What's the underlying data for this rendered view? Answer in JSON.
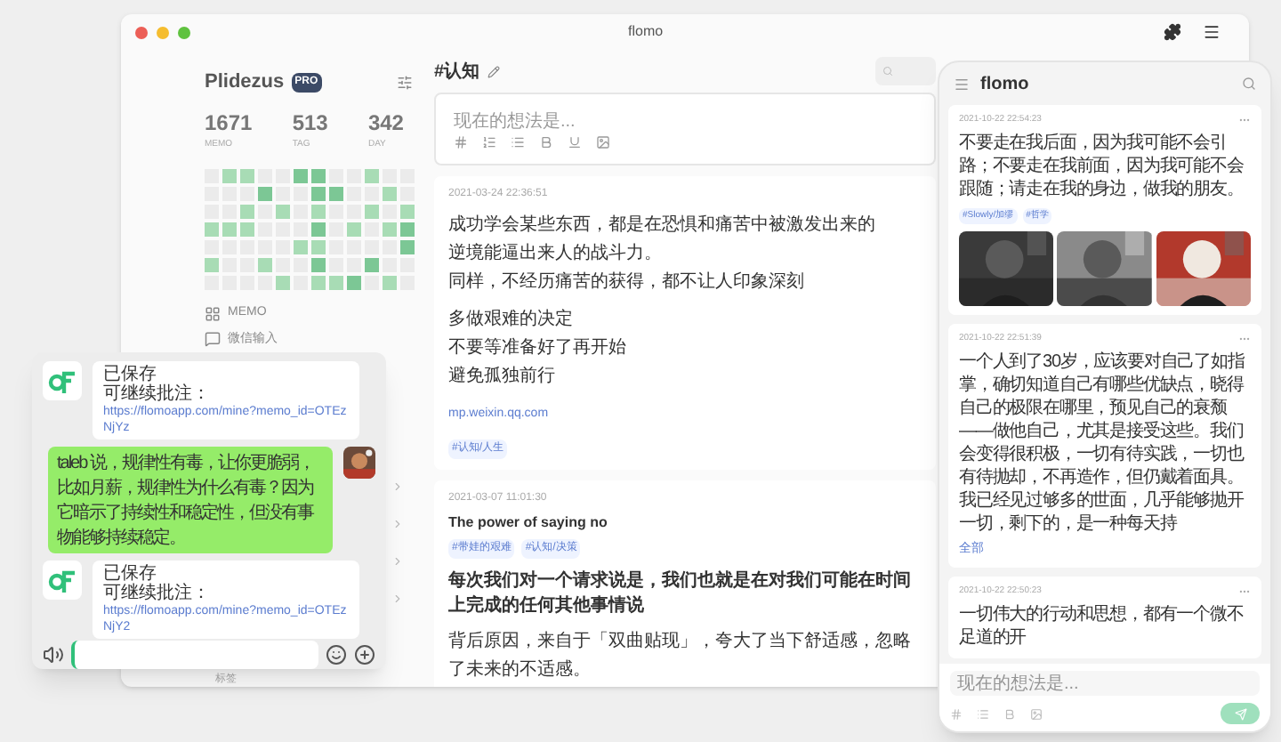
{
  "window": {
    "title": "flomo"
  },
  "sidebar": {
    "user": "Plidezus",
    "badge": "PRO",
    "stats": [
      {
        "value": "1671",
        "label": "MEMO"
      },
      {
        "value": "513",
        "label": "TAG"
      },
      {
        "value": "342",
        "label": "DAY"
      }
    ],
    "items": [
      {
        "kind": "memo",
        "label": "MEMO"
      },
      {
        "kind": "wechat",
        "label": "微信输入"
      }
    ],
    "footer": "标签"
  },
  "main": {
    "title": "#认知",
    "editor": {
      "placeholder": "现在的想法是..."
    },
    "memos": [
      {
        "time": "2021-03-24 22:36:51",
        "paragraphs": [
          [
            "成功学会某些东西，都是在恐惧和痛苦中被激发出来的",
            "逆境能逼出来人的战斗力。",
            "同样，不经历痛苦的获得，都不让人印象深刻"
          ],
          [
            "多做艰难的决定",
            "不要等准备好了再开始",
            "避免孤独前行"
          ]
        ],
        "link": "mp.weixin.qq.com",
        "tags": [
          "#认知/人生"
        ]
      },
      {
        "time": "2021-03-07 11:01:30",
        "title": "The power of saying no",
        "tags": [
          "#带娃的艰难",
          "#认知/决策"
        ],
        "lead": "每次我们对一个请求说是，我们也就是在对我们可能在时间上完成的任何其他事情说",
        "paragraphs": [
          [
            "背后原因，来自于「双曲贴现」，夸大了当下舒适感，忽略了未来的不适感。"
          ]
        ]
      }
    ]
  },
  "phone": {
    "brand": "flomo",
    "memos": [
      {
        "time": "2021-10-22 22:54:23",
        "text": "不要走在我后面，因为我可能不会引路；不要走在我前面，因为我可能不会跟随；请走在我的身边，做我的朋友。",
        "tags": [
          "#Slowly/加缪",
          "#哲学"
        ],
        "pictures": [
          {
            "kind": "picture"
          },
          {
            "kind": "picture"
          },
          {
            "kind": "picture"
          }
        ]
      },
      {
        "time": "2021-10-22 22:51:39",
        "text": "一个人到了30岁，应该要对自己了如指掌，确切知道自己有哪些优缺点，晓得自己的极限在哪里，预见自己的衰颓——做他自己，尤其是接受这些。我们会变得很积极，一切有待实践，一切也有待抛却，不再造作，但仍戴着面具。我已经见过够多的世面，几乎能够抛开一切，剩下的，是一种每天持",
        "more": "全部"
      },
      {
        "time": "2021-10-22 22:50:23",
        "text": "一切伟大的行动和思想，都有一个微不足道的开"
      }
    ],
    "editor": {
      "placeholder": "现在的想法是..."
    }
  },
  "chat": {
    "messages": [
      {
        "kind": "bot",
        "lines": [
          "已保存",
          "可继续批注："
        ],
        "link": "https://flomoapp.com/mine?memo_id=OTEzNjYz"
      },
      {
        "kind": "user",
        "text": "taleb 说，规律性有毒，让你更脆弱，比如月薪，规律性为什么有毒？因为它暗示了持续性和稳定性，但没有事物能够持续稳定。"
      },
      {
        "kind": "bot",
        "lines": [
          "已保存",
          "可继续批注："
        ],
        "link": "https://flomoapp.com/mine?memo_id=OTEzNjY2"
      }
    ]
  }
}
